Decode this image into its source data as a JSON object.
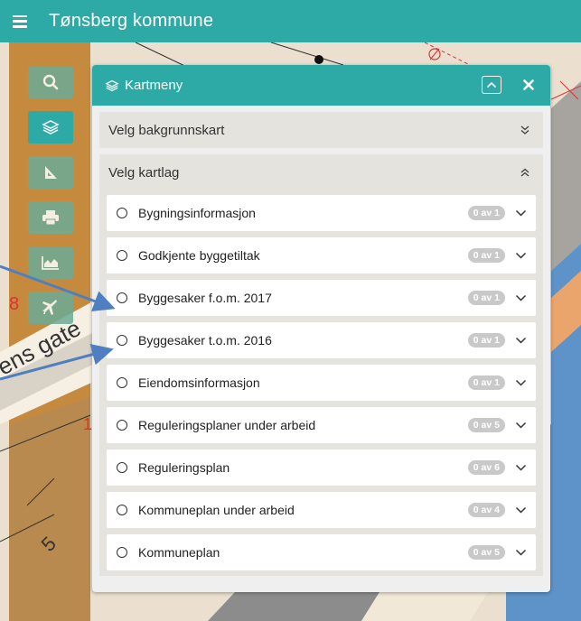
{
  "header": {
    "menu_icon": "hamburger-icon",
    "title": "Tønsberg kommune"
  },
  "toolbar": {
    "buttons": [
      {
        "name": "search-icon"
      },
      {
        "name": "layers-icon"
      },
      {
        "name": "measure-icon"
      },
      {
        "name": "print-icon"
      },
      {
        "name": "profile-chart-icon"
      },
      {
        "name": "airplane-icon"
      }
    ]
  },
  "map": {
    "labels": [
      "8",
      "ens gate",
      "5",
      "1"
    ]
  },
  "panel": {
    "title": "Kartmeny",
    "icon": "layers-icon",
    "sections": {
      "background": {
        "label": "Velg bakgrunnskart"
      },
      "layers": {
        "label": "Velg kartlag",
        "items": [
          {
            "label": "Bygningsinformasjon",
            "count": "0 av 1"
          },
          {
            "label": "Godkjente byggetiltak",
            "count": "0 av 1"
          },
          {
            "label": "Byggesaker f.o.m. 2017",
            "count": "0 av 1"
          },
          {
            "label": "Byggesaker t.o.m. 2016",
            "count": "0 av 1"
          },
          {
            "label": "Eiendomsinformasjon",
            "count": "0 av 1"
          },
          {
            "label": "Reguleringsplaner under arbeid",
            "count": "0 av 5"
          },
          {
            "label": "Reguleringsplan",
            "count": "0 av 6"
          },
          {
            "label": "Kommuneplan under arbeid",
            "count": "0 av 4"
          },
          {
            "label": "Kommuneplan",
            "count": "0 av 5"
          }
        ]
      }
    }
  },
  "colors": {
    "accent": "#2eaaa6",
    "panel_bg": "#efefef",
    "section_bg": "#e4e3de",
    "badge": "#c9c9c9",
    "arrow": "#4f7fc0"
  }
}
